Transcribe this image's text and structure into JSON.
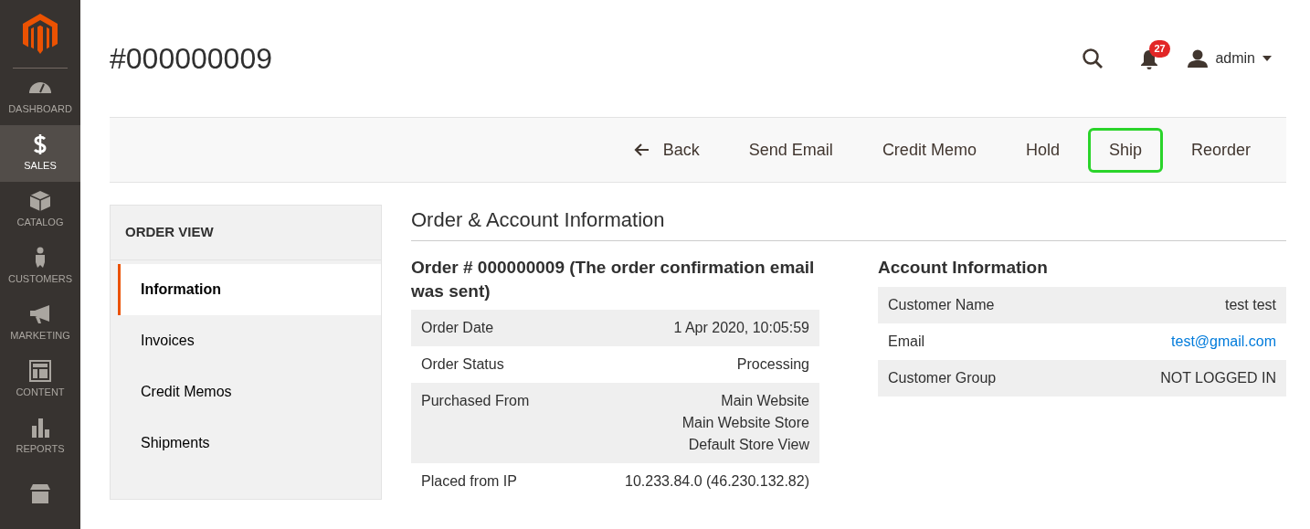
{
  "sidebar": {
    "items": [
      {
        "label": "DASHBOARD",
        "selected": false
      },
      {
        "label": "SALES",
        "selected": true
      },
      {
        "label": "CATALOG",
        "selected": false
      },
      {
        "label": "CUSTOMERS",
        "selected": false
      },
      {
        "label": "MARKETING",
        "selected": false
      },
      {
        "label": "CONTENT",
        "selected": false
      },
      {
        "label": "REPORTS",
        "selected": false
      },
      {
        "selected": false
      }
    ]
  },
  "page_title": "#000000009",
  "header": {
    "notifications_count": "27",
    "user": "admin"
  },
  "actions": [
    {
      "label": "Back",
      "kind": "back",
      "highlighted": false
    },
    {
      "label": "Send Email",
      "kind": "plain",
      "highlighted": false
    },
    {
      "label": "Credit Memo",
      "kind": "plain",
      "highlighted": false
    },
    {
      "label": "Hold",
      "kind": "plain",
      "highlighted": false
    },
    {
      "label": "Ship",
      "kind": "plain",
      "highlighted": true
    },
    {
      "label": "Reorder",
      "kind": "plain",
      "highlighted": false
    }
  ],
  "order_view": {
    "title": "ORDER VIEW",
    "tabs": [
      {
        "label": "Information",
        "selected": true
      },
      {
        "label": "Invoices",
        "selected": false
      },
      {
        "label": "Credit Memos",
        "selected": false
      },
      {
        "label": "Shipments",
        "selected": false
      }
    ]
  },
  "section_title": "Order & Account Information",
  "order": {
    "title": "Order # 000000009 (The order confirmation email was sent)",
    "rows": [
      {
        "label": "Order Date",
        "value": [
          "1 Apr 2020, 10:05:59"
        ]
      },
      {
        "label": "Order Status",
        "value": [
          "Processing"
        ]
      },
      {
        "label": "Purchased From",
        "value": [
          "Main Website",
          "Main Website Store",
          "Default Store View"
        ]
      },
      {
        "label": "Placed from IP",
        "value": [
          "10.233.84.0 (46.230.132.82)"
        ]
      }
    ]
  },
  "account": {
    "title": "Account Information",
    "rows": [
      {
        "label": "Customer Name",
        "value": "test test",
        "link": false
      },
      {
        "label": "Email",
        "value": "test@gmail.com",
        "link": true
      },
      {
        "label": "Customer Group",
        "value": "NOT LOGGED IN",
        "link": false
      }
    ]
  }
}
